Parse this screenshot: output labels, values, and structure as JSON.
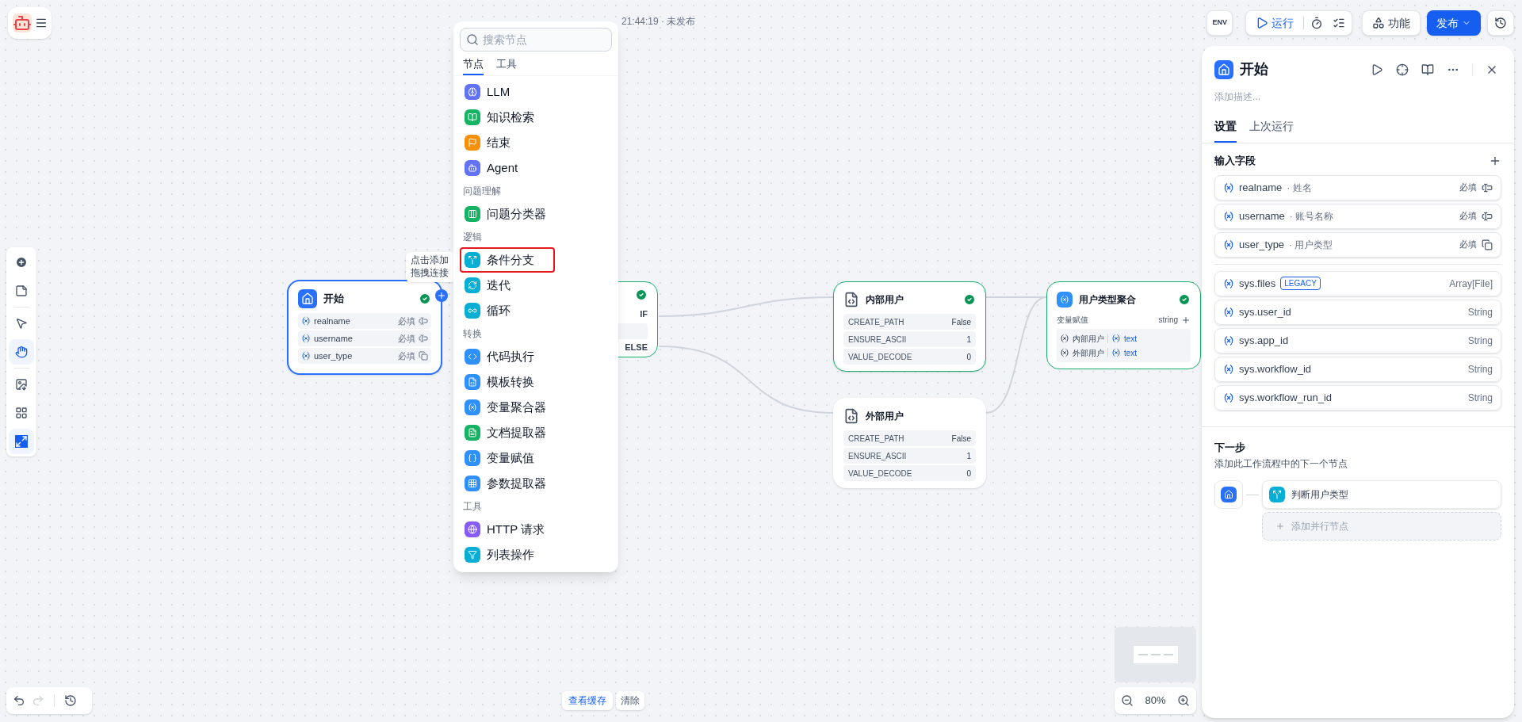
{
  "header": {
    "autosave": "21:44:19 · 未发布",
    "env": "ENV",
    "run": "运行",
    "features": "功能",
    "publish": "发布"
  },
  "left_toolbar": {
    "modes": [
      {
        "selected": false
      },
      {
        "selected": true
      }
    ],
    "maximize_on": true
  },
  "canvas": {
    "start_node": {
      "title": "开始",
      "succeeded": true,
      "fields": [
        {
          "name": "realname",
          "required": "必填",
          "kind": "text"
        },
        {
          "name": "username",
          "required": "必填",
          "kind": "text"
        },
        {
          "name": "user_type",
          "required": "必填",
          "kind": "select"
        }
      ]
    },
    "tooltip": [
      "点击添加",
      "拖拽连接"
    ],
    "branch_node": {
      "succeeded": true,
      "cases": [
        "IF",
        "ELSE"
      ]
    },
    "code_nodes": [
      {
        "title": "内部用户",
        "succeeded": true,
        "params": [
          {
            "key": "CREATE_PATH",
            "value": "False"
          },
          {
            "key": "ENSURE_ASCII",
            "value": "1"
          },
          {
            "key": "VALUE_DECODE",
            "value": "0"
          }
        ]
      },
      {
        "title": "外部用户",
        "succeeded": false,
        "params": [
          {
            "key": "CREATE_PATH",
            "value": "False"
          },
          {
            "key": "ENSURE_ASCII",
            "value": "1"
          },
          {
            "key": "VALUE_DECODE",
            "value": "0"
          }
        ]
      }
    ],
    "aggregator_node": {
      "title": "用户类型聚合",
      "succeeded": true,
      "label": "变量赋值",
      "type": "string",
      "vars": [
        {
          "node": "内部用户",
          "var": "text"
        },
        {
          "node": "外部用户",
          "var": "text"
        }
      ]
    }
  },
  "node_menu": {
    "search": {
      "placeholder": "搜索节点"
    },
    "tabs": [
      {
        "label": "节点",
        "selected": true
      },
      {
        "label": "工具",
        "selected": false
      }
    ],
    "entries": [
      {
        "kind": "item",
        "label": "LLM",
        "color": "#6172f3",
        "highlighted": false
      },
      {
        "kind": "item",
        "label": "知识检索",
        "color": "#16b364",
        "highlighted": false
      },
      {
        "kind": "item",
        "label": "结束",
        "color": "#f79009",
        "highlighted": false
      },
      {
        "kind": "item",
        "label": "Agent",
        "color": "#6172f3",
        "highlighted": false
      },
      {
        "kind": "heading",
        "label": "问题理解"
      },
      {
        "kind": "item",
        "label": "问题分类器",
        "color": "#16b364",
        "highlighted": false
      },
      {
        "kind": "heading",
        "label": "逻辑"
      },
      {
        "kind": "item",
        "label": "条件分支",
        "color": "#06aed4",
        "highlighted": true
      },
      {
        "kind": "item",
        "label": "迭代",
        "color": "#06aed4",
        "highlighted": false
      },
      {
        "kind": "item",
        "label": "循环",
        "color": "#06aed4",
        "highlighted": false
      },
      {
        "kind": "heading",
        "label": "转换"
      },
      {
        "kind": "item",
        "label": "代码执行",
        "color": "#2e90fa",
        "highlighted": false
      },
      {
        "kind": "item",
        "label": "模板转换",
        "color": "#2e90fa",
        "highlighted": false
      },
      {
        "kind": "item",
        "label": "变量聚合器",
        "color": "#2e90fa",
        "highlighted": false
      },
      {
        "kind": "item",
        "label": "文档提取器",
        "color": "#16b364",
        "highlighted": false
      },
      {
        "kind": "item",
        "label": "变量赋值",
        "color": "#2e90fa",
        "highlighted": false
      },
      {
        "kind": "item",
        "label": "参数提取器",
        "color": "#2e90fa",
        "highlighted": false
      },
      {
        "kind": "heading",
        "label": "工具"
      },
      {
        "kind": "item",
        "label": "HTTP 请求",
        "color": "#875bf7",
        "highlighted": false
      },
      {
        "kind": "item",
        "label": "列表操作",
        "color": "#06aed4",
        "highlighted": false
      }
    ]
  },
  "panel": {
    "title": "开始",
    "description": {
      "placeholder": "添加描述..."
    },
    "tabs": [
      {
        "label": "设置",
        "selected": true
      },
      {
        "label": "上次运行",
        "selected": false
      }
    ],
    "inputs_title": "输入字段",
    "inputs": [
      {
        "name": "realname",
        "label": "· 姓名",
        "required": "必填",
        "kind": "text"
      },
      {
        "name": "username",
        "label": "· 账号名称",
        "required": "必填",
        "kind": "text"
      },
      {
        "name": "user_type",
        "label": "· 用户类型",
        "required": "必填",
        "kind": "select"
      }
    ],
    "system": [
      {
        "name": "sys.files",
        "badge": "LEGACY",
        "type": "Array[File]"
      },
      {
        "name": "sys.user_id",
        "type": "String"
      },
      {
        "name": "sys.app_id",
        "type": "String"
      },
      {
        "name": "sys.workflow_id",
        "type": "String"
      },
      {
        "name": "sys.workflow_run_id",
        "type": "String"
      }
    ],
    "next": {
      "title": "下一步",
      "hint": "添加此工作流程中的下一个节点",
      "node": "判断用户类型",
      "add_parallel": "添加并行节点"
    }
  },
  "bottom": {
    "cache": "查看缓存",
    "clear": "清除",
    "zoom": "80%"
  }
}
